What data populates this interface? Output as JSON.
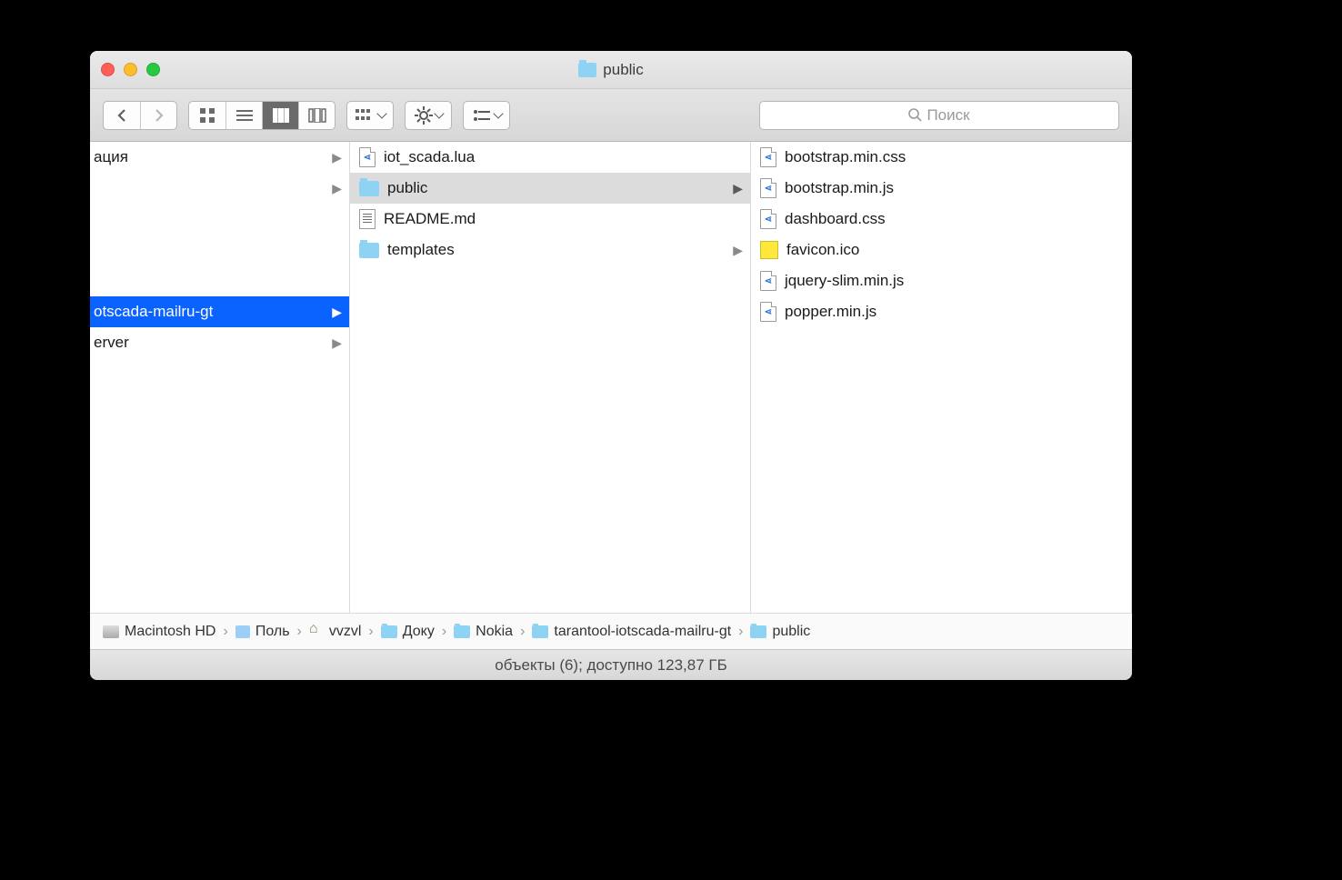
{
  "title": "public",
  "search_placeholder": "Поиск",
  "col0": [
    {
      "name": "ация",
      "folder": false,
      "hasChildren": true,
      "selected": false
    },
    {
      "name": "",
      "folder": false,
      "hasChildren": true,
      "selected": false
    },
    {
      "name": "",
      "folder": false,
      "hasChildren": false,
      "selected": false
    },
    {
      "name": "",
      "folder": false,
      "hasChildren": false,
      "selected": false
    },
    {
      "name": "",
      "folder": false,
      "hasChildren": false,
      "selected": false
    },
    {
      "name": "otscada-mailru-gt",
      "folder": false,
      "hasChildren": true,
      "selected": true
    },
    {
      "name": "erver",
      "folder": false,
      "hasChildren": true,
      "selected": false
    }
  ],
  "col1": [
    {
      "name": "iot_scada.lua",
      "type": "code",
      "hasChildren": false,
      "selected": false
    },
    {
      "name": "public",
      "type": "folder",
      "hasChildren": true,
      "selected": true
    },
    {
      "name": "README.md",
      "type": "md",
      "hasChildren": false,
      "selected": false
    },
    {
      "name": "templates",
      "type": "folder",
      "hasChildren": true,
      "selected": false
    }
  ],
  "col2": [
    {
      "name": "bootstrap.min.css",
      "type": "code"
    },
    {
      "name": "bootstrap.min.js",
      "type": "code"
    },
    {
      "name": "dashboard.css",
      "type": "code"
    },
    {
      "name": "favicon.ico",
      "type": "ico"
    },
    {
      "name": "jquery-slim.min.js",
      "type": "code"
    },
    {
      "name": "popper.min.js",
      "type": "code"
    }
  ],
  "path": [
    {
      "label": "Macintosh HD",
      "icon": "disk"
    },
    {
      "label": "Поль",
      "icon": "user"
    },
    {
      "label": "vvzvl",
      "icon": "home"
    },
    {
      "label": "Доку",
      "icon": "folder"
    },
    {
      "label": "Nokia",
      "icon": "folder"
    },
    {
      "label": "tarantool-iotscada-mailru-gt",
      "icon": "folder"
    },
    {
      "label": "public",
      "icon": "folder"
    }
  ],
  "status": "объекты (6); доступно 123,87 ГБ"
}
